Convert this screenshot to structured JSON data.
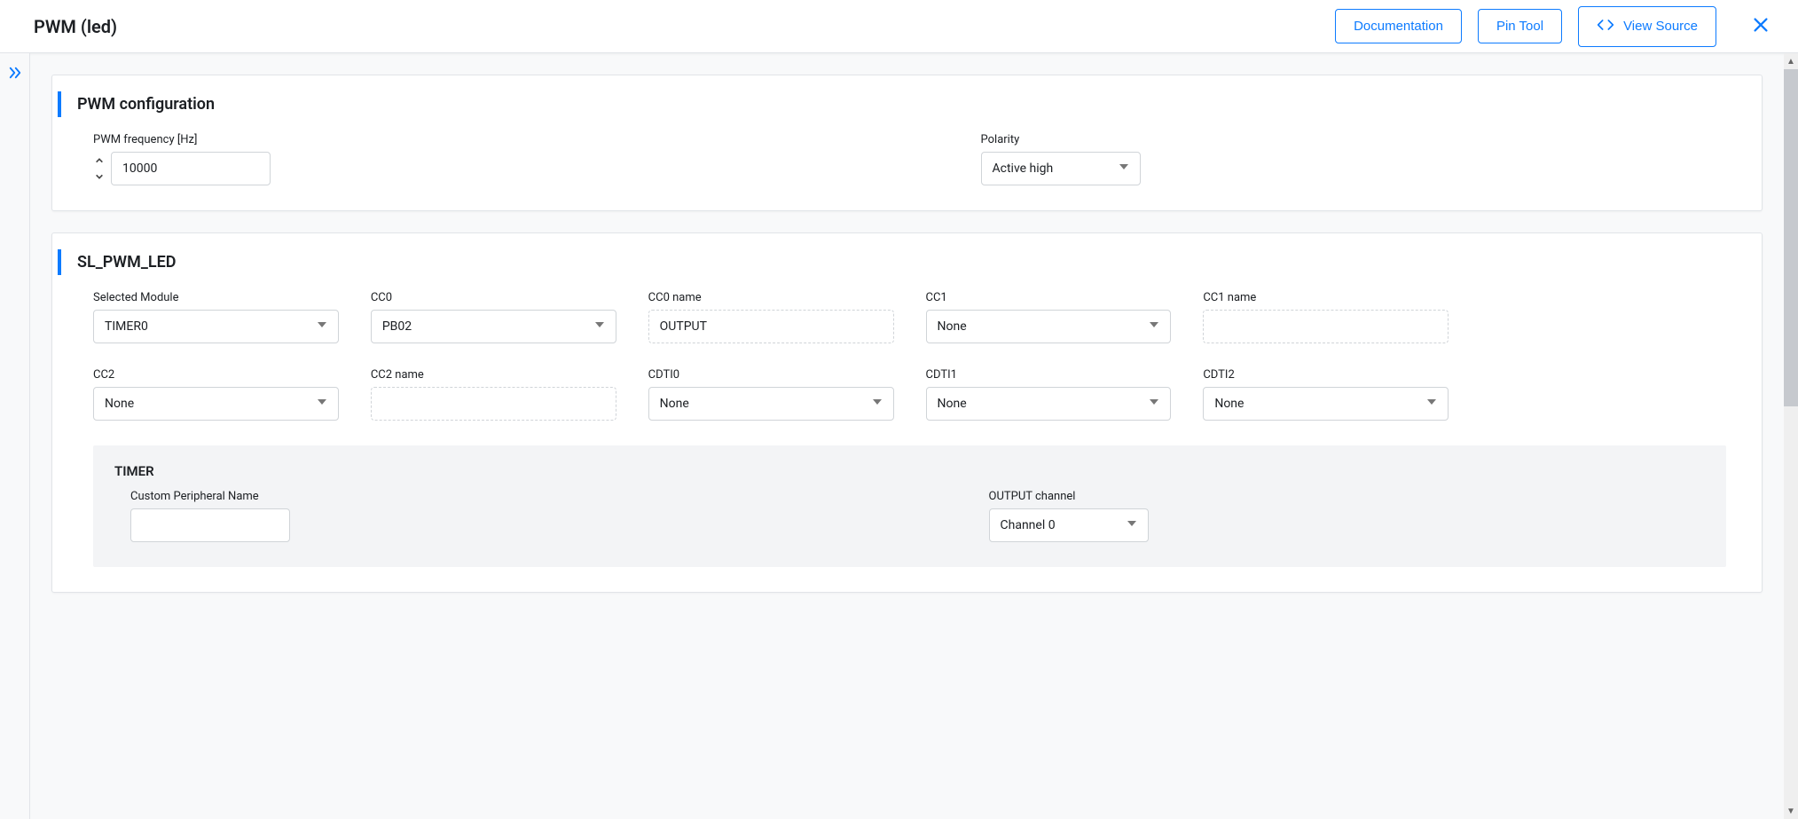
{
  "header": {
    "title": "PWM (led)",
    "documentation_label": "Documentation",
    "pin_tool_label": "Pin Tool",
    "view_source_label": "View Source"
  },
  "card1": {
    "title": "PWM configuration",
    "frequency": {
      "label": "PWM frequency [Hz]",
      "value": "10000"
    },
    "polarity": {
      "label": "Polarity",
      "value": "Active high"
    }
  },
  "card2": {
    "title": "SL_PWM_LED",
    "fields": {
      "selected_module": {
        "label": "Selected Module",
        "value": "TIMER0"
      },
      "cc0": {
        "label": "CC0",
        "value": "PB02"
      },
      "cc0_name": {
        "label": "CC0 name",
        "value": "OUTPUT"
      },
      "cc1": {
        "label": "CC1",
        "value": "None"
      },
      "cc1_name": {
        "label": "CC1 name",
        "value": ""
      },
      "cc2": {
        "label": "CC2",
        "value": "None"
      },
      "cc2_name": {
        "label": "CC2 name",
        "value": ""
      },
      "cdti0": {
        "label": "CDTI0",
        "value": "None"
      },
      "cdti1": {
        "label": "CDTI1",
        "value": "None"
      },
      "cdti2": {
        "label": "CDTI2",
        "value": "None"
      }
    },
    "subpanel": {
      "title": "TIMER",
      "custom_name": {
        "label": "Custom Peripheral Name",
        "value": ""
      },
      "output_channel": {
        "label": "OUTPUT channel",
        "value": "Channel 0"
      }
    }
  }
}
